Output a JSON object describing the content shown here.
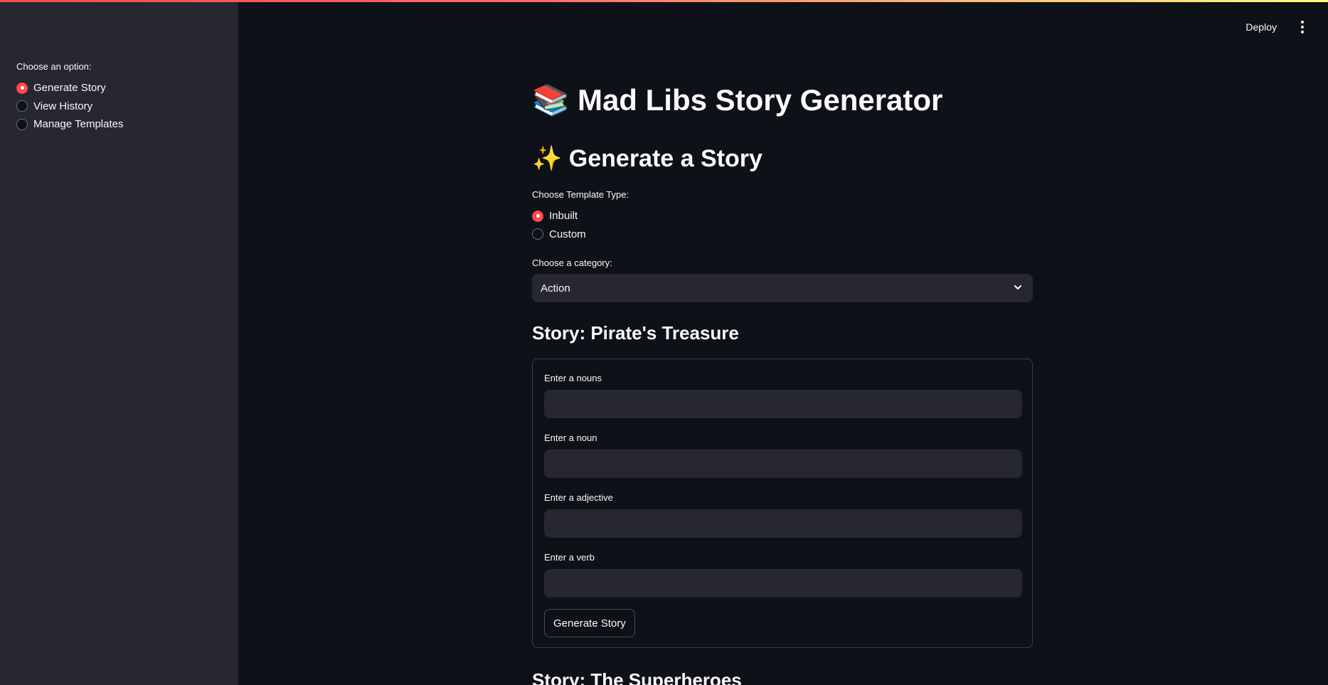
{
  "sidebar": {
    "label": "Choose an option:",
    "options": [
      {
        "label": "Generate Story",
        "selected": true
      },
      {
        "label": "View History",
        "selected": false
      },
      {
        "label": "Manage Templates",
        "selected": false
      }
    ]
  },
  "header": {
    "deploy_label": "Deploy",
    "menu_icon": "vertical-ellipsis-icon"
  },
  "main": {
    "title": "📚 Mad Libs Story Generator",
    "section_title": "✨ Generate a Story",
    "template_type": {
      "label": "Choose Template Type:",
      "options": [
        {
          "label": "Inbuilt",
          "selected": true
        },
        {
          "label": "Custom",
          "selected": false
        }
      ]
    },
    "category": {
      "label": "Choose a category:",
      "value": "Action"
    },
    "stories": [
      {
        "title": "Story: Pirate's Treasure",
        "fields": [
          {
            "label": "Enter a nouns",
            "value": ""
          },
          {
            "label": "Enter a noun",
            "value": ""
          },
          {
            "label": "Enter a adjective",
            "value": ""
          },
          {
            "label": "Enter a verb",
            "value": ""
          }
        ],
        "button_label": "Generate Story"
      },
      {
        "title": "Story: The Superheroes"
      }
    ]
  },
  "colors": {
    "accent": "#ff4b4b",
    "background": "#0e1117",
    "sidebar": "#262730",
    "input": "#262730"
  }
}
